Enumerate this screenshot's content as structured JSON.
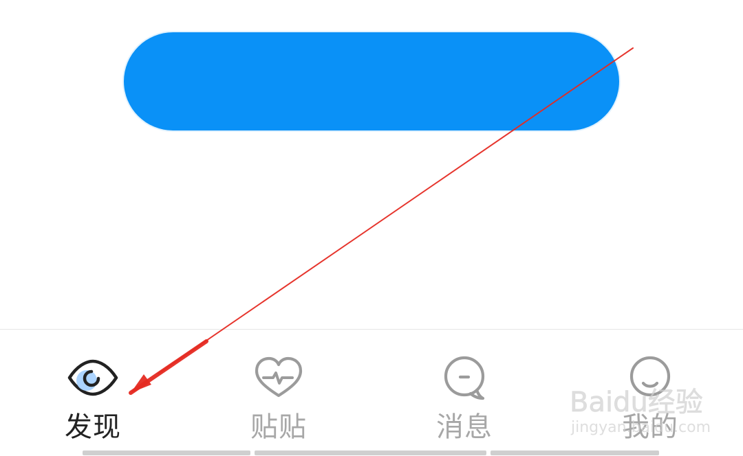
{
  "top_button": {
    "label": "",
    "blurred_label": "",
    "color": "#0a91f7"
  },
  "tab_bar": {
    "tabs": [
      {
        "label": "发现",
        "icon": "eye-icon",
        "active": true
      },
      {
        "label": "贴贴",
        "icon": "heart-pulse-icon",
        "active": false
      },
      {
        "label": "消息",
        "icon": "chat-bubble-icon",
        "active": false
      },
      {
        "label": "我的",
        "icon": "smile-icon",
        "active": false
      }
    ]
  },
  "annotation": {
    "arrow_color": "#e52b22"
  },
  "watermark": {
    "main": "Baidu经验",
    "sub": "jingyan.baidu.com"
  },
  "colors": {
    "tab_active": "#222222",
    "tab_inactive": "#a7a7a7",
    "divider": "#e6e6e6",
    "eye_fill": "#a8d2ff"
  }
}
